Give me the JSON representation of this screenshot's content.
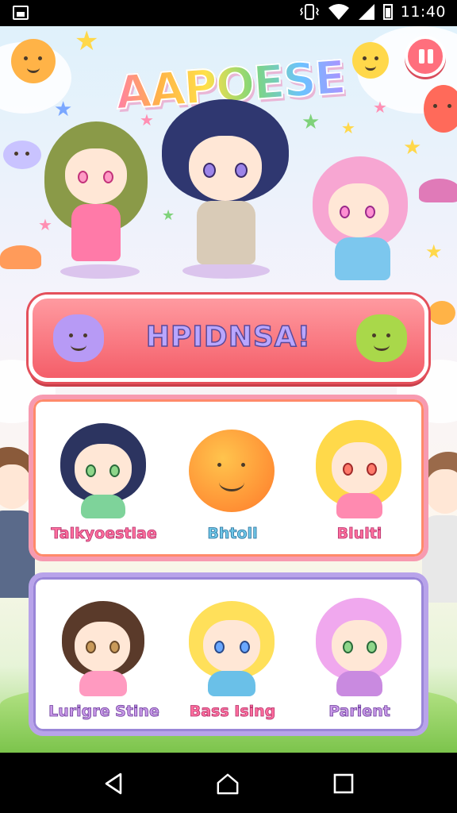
{
  "status_bar": {
    "time": "11:40",
    "icons": [
      "image-notification-icon",
      "vibrate-icon",
      "wifi-icon",
      "cellular-signal-icon",
      "battery-icon"
    ]
  },
  "game": {
    "title": "AAPOESE",
    "play_button_label": "HPIDNSA!",
    "characters_row1": [
      {
        "label": "Talkyoestlae"
      },
      {
        "label": "Bhtoll"
      },
      {
        "label": "Blulti"
      }
    ],
    "characters_row2": [
      {
        "label": "Lurigre Stine"
      },
      {
        "label": "Bass Ising"
      },
      {
        "label": "Parient"
      }
    ]
  },
  "colors": {
    "play_button": "#f45e69",
    "pause_button": "#ff6f7d",
    "panel_top_border": "#f79ab0",
    "panel_bottom_border": "#b8a3ea"
  },
  "nav_bar": {
    "icons": [
      "back-icon",
      "home-icon",
      "recent-apps-icon"
    ]
  }
}
